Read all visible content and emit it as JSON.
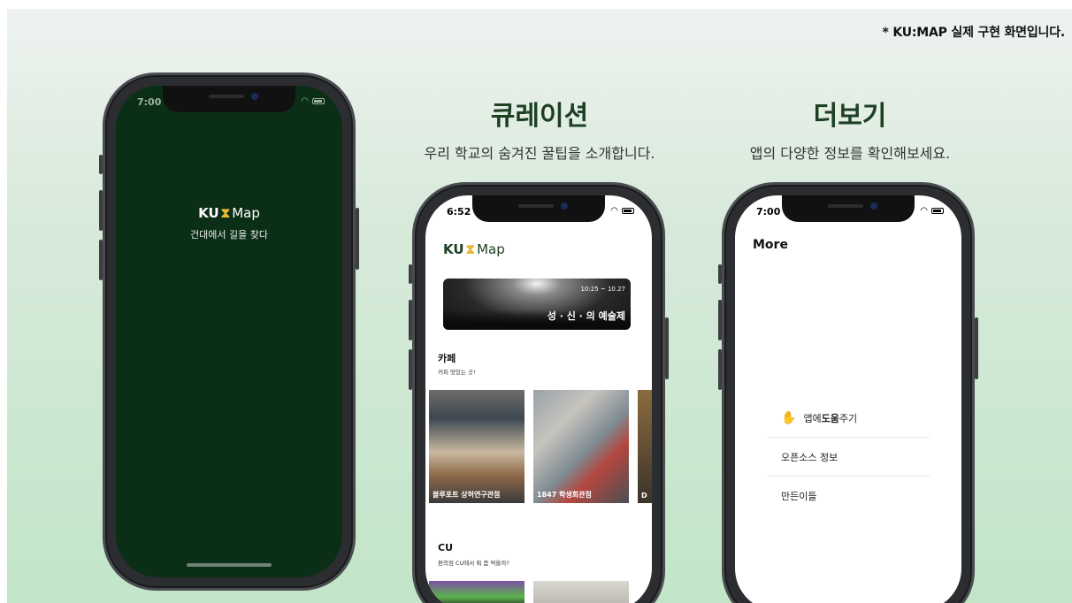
{
  "footnote": "* KU:MAP 실제 구현 화면입니다.",
  "sections": {
    "curation": {
      "title": "큐레이션",
      "subtitle": "우리 학교의 숨겨진 꿀팁을 소개합니다."
    },
    "more": {
      "title": "더보기",
      "subtitle": "앱의 다양한 정보를 확인해보세요."
    }
  },
  "phone1": {
    "time": "7:00",
    "logo_ku": "KU",
    "logo_hourglass": "⧗",
    "logo_map": "Map",
    "tagline": "건대에서 길을 찾다"
  },
  "phone2": {
    "time": "6:52",
    "logo_ku": "KU",
    "logo_hourglass": "⧗",
    "logo_map": "Map",
    "banner": {
      "date": "10:25 ~ 10.27",
      "title": "성 · 신 · 의 예술제"
    },
    "categories": [
      {
        "title": "카페",
        "subtitle": "커피 맛있는 곳!",
        "cards": [
          "블루포트 상허연구관점",
          "1847 학생회관점",
          "D"
        ]
      },
      {
        "title": "CU",
        "subtitle": "편의점 CU에서 뭐 좀 먹을까?"
      }
    ]
  },
  "phone3": {
    "time": "7:00",
    "title": "More",
    "items": [
      {
        "icon": "helping-hand-icon",
        "pre": "앱에 ",
        "bold": "도움",
        "post": "주기"
      },
      {
        "label": "오픈소스 정보"
      },
      {
        "label": "만든이들"
      }
    ]
  },
  "colors": {
    "brand_green": "#0b2e16",
    "accent_gold": "#e8b83a",
    "title_green": "#1d4023"
  }
}
